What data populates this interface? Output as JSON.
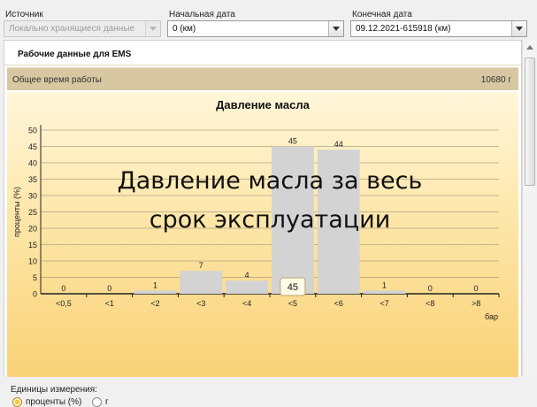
{
  "source": {
    "label": "Источник",
    "value": "Локально хранящиеся данные"
  },
  "start_date": {
    "label": "Начальная дата",
    "value": "0 (км)"
  },
  "end_date": {
    "label": "Конечная дата",
    "value": "09.12.2021-615918 (км)"
  },
  "section": {
    "title": "Рабочие данные для EMS",
    "total_label": "Общее время работы",
    "total_value": "10680  г"
  },
  "units": {
    "title": "Единицы измерения:",
    "options": [
      {
        "label": "проценты (%)",
        "checked": true
      },
      {
        "label": "г",
        "checked": false
      }
    ]
  },
  "chart_data": {
    "type": "bar",
    "title": "Давление масла",
    "overlay_text": [
      "Давление масла за весь",
      "срок эксплуатации"
    ],
    "xlabel": "бар",
    "ylabel": "проценты (%)",
    "categories": [
      "<0,5",
      "<1",
      "<2",
      "<3",
      "<4",
      "<5",
      "<6",
      "<7",
      "<8",
      ">8"
    ],
    "values": [
      0,
      0,
      1,
      7,
      4,
      45,
      44,
      1,
      0,
      0
    ],
    "ylim": [
      0,
      50
    ],
    "yticks": [
      0,
      5,
      10,
      15,
      20,
      25,
      30,
      35,
      40,
      45,
      50
    ],
    "grid": true,
    "tooltip": {
      "category": "<5",
      "text": "45"
    },
    "bar_color": "#d3d3d3"
  }
}
